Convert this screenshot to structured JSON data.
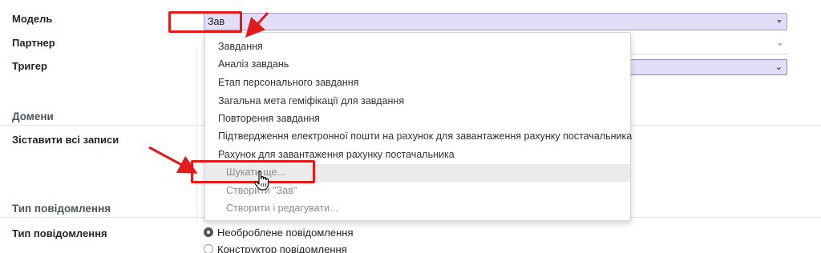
{
  "form": {
    "model_label": "Модель",
    "model_value": "Зав",
    "partner_label": "Партнер",
    "trigger_label": "Тригер",
    "domains_section": "Домени",
    "match_all_label": "Зіставити всі записи",
    "message_type_section": "Тип повідомлення",
    "message_type_label": "Тип повідомлення",
    "message_options": [
      "Необроблене повідомлення",
      "Конструктор повідомлення"
    ],
    "selected_option": "Необроблене повідомлення"
  },
  "dropdown": {
    "items": [
      "Завдання",
      "Аналіз завдань",
      "Етап персонального завдання",
      "Загальна мета геміфікації для завдання",
      "Повторення завдання",
      "Підтвердження електронної пошти на рахунок для завантаження рахунку постачальника",
      "Рахунок для завантаження рахунку постачальника"
    ],
    "search_more": "Шукати ще...",
    "create": "Створити \"Зав\"",
    "create_edit": "Створити і редагувати..."
  },
  "annotation_color": "#e11b1b"
}
